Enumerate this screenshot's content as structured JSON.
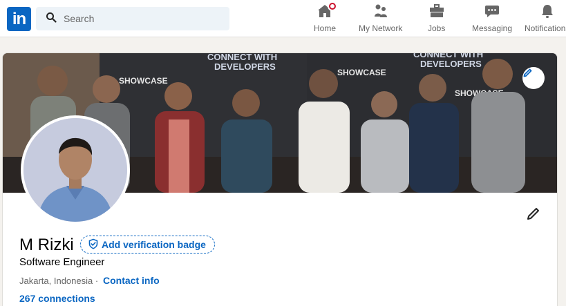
{
  "nav": {
    "logo_text": "in",
    "search_placeholder": "Search",
    "items": [
      {
        "label": "Home",
        "icon": "home-icon"
      },
      {
        "label": "My Network",
        "icon": "people-icon"
      },
      {
        "label": "Jobs",
        "icon": "briefcase-icon"
      },
      {
        "label": "Messaging",
        "icon": "chat-icon"
      },
      {
        "label": "Notifications",
        "icon": "bell-icon"
      }
    ]
  },
  "banner": {
    "texts": [
      "CONNECT WITH",
      "DEVELOPERS",
      "SHOWCASE",
      "SHOWCASE",
      "CONNECT WITH",
      "DEVELOPERS",
      "SHOWCASE"
    ]
  },
  "profile": {
    "name": "M Rizki",
    "verification_label": "Add verification badge",
    "headline": "Software Engineer",
    "location": "Jakarta, Indonesia",
    "separator": "·",
    "contact_info": "Contact info",
    "connections": "267 connections"
  },
  "colors": {
    "brand": "#0a66c2",
    "notification": "#cb112d"
  }
}
